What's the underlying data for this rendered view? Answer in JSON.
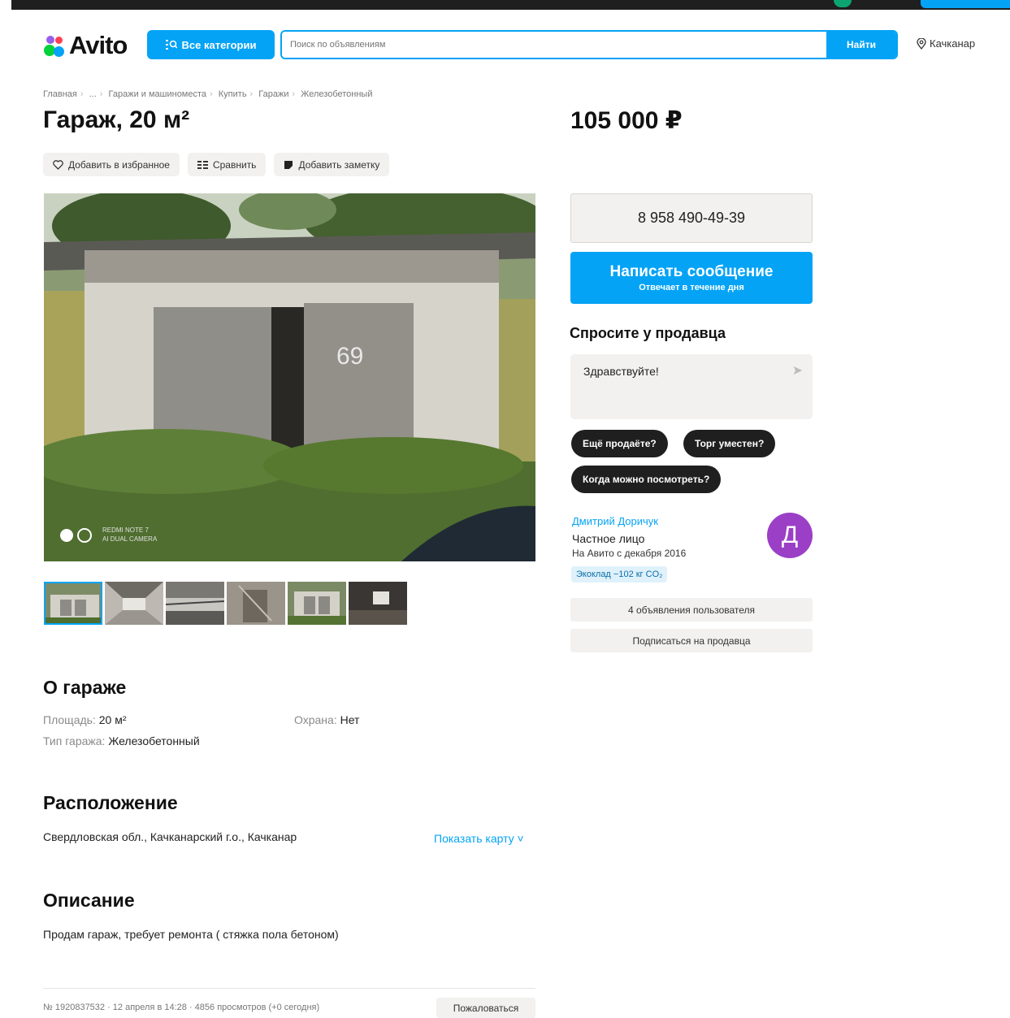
{
  "header": {
    "logo_text": "Avito",
    "categories_label": "Все категории",
    "search_placeholder": "Поиск по объявлениям",
    "search_button": "Найти",
    "location": "Качканар"
  },
  "breadcrumbs": [
    "Главная",
    "...",
    "Гаражи и машиноместа",
    "Купить",
    "Гаражи",
    "Железобетонный"
  ],
  "listing": {
    "title": "Гараж, 20 м²",
    "price": "105 000 ₽",
    "actions": {
      "favorite": "Добавить в избранное",
      "compare": "Сравнить",
      "note": "Добавить заметку"
    },
    "photo_watermark_line1": "REDMI NOTE 7",
    "photo_watermark_line2": "AI DUAL CAMERA",
    "thumbnail_count": 6
  },
  "contact": {
    "phone": "8 958 490-49-39",
    "message_button": "Написать сообщение",
    "message_sub": "Отвечает в течение дня",
    "ask_title": "Спросите у продавца",
    "ask_text": "Здравствуйте!",
    "chips": [
      "Ещё продаёте?",
      "Торг уместен?",
      "Когда можно посмотреть?"
    ]
  },
  "seller": {
    "name": "Дмитрий Доричук",
    "type": "Частное лицо",
    "since": "На Авито с декабря 2016",
    "eco": "Экоклад −102 кг CO₂",
    "avatar_letter": "Д",
    "listings_button": "4 объявления пользователя",
    "subscribe_button": "Подписаться на продавца"
  },
  "about": {
    "heading": "О гараже",
    "area_key": "Площадь:",
    "area_val": "20 м²",
    "type_key": "Тип гаража:",
    "type_val": "Железобетонный",
    "security_key": "Охрана:",
    "security_val": "Нет"
  },
  "location_section": {
    "heading": "Расположение",
    "address": "Свердловская обл., Качканарский г.о., Качканар",
    "map_link": "Показать карту ˅"
  },
  "description": {
    "heading": "Описание",
    "text": "Продам гараж, требует ремонта ( стяжка пола бетоном)"
  },
  "footer": {
    "meta": "№ 1920837532 · 12 апреля в 14:28 · 4856 просмотров (+0 сегодня)",
    "report": "Пожаловаться"
  },
  "colors": {
    "accent": "#04a3f5",
    "chip_bg": "#1f1f1f",
    "grey_btn": "#f2f1ef",
    "avatar": "#9b3fc7"
  }
}
